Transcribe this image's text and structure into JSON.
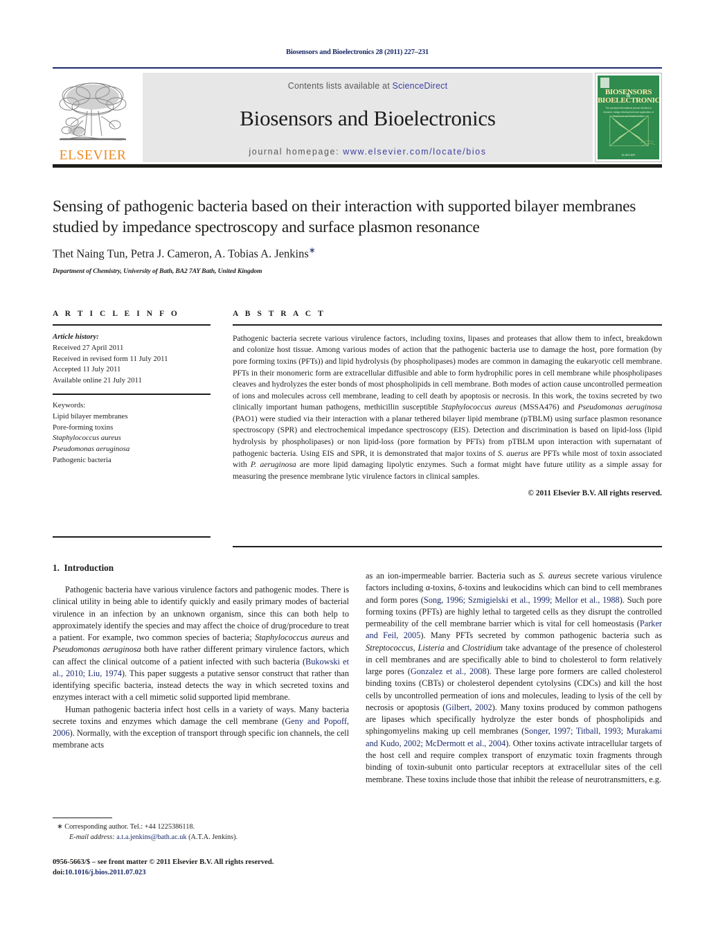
{
  "header": {
    "running_head": "Biosensors and Bioelectronics 28 (2011) 227–231",
    "contents_prefix": "Contents lists available at ",
    "contents_link": "ScienceDirect",
    "journal_title": "Biosensors and Bioelectronics",
    "homepage_prefix": "journal homepage: ",
    "homepage_url": "www.elsevier.com/locate/bios",
    "publisher_logo_text": "ELSEVIER",
    "cover": {
      "line1": "BIOSENSORS",
      "amp": "&",
      "line2": "BIOELECTRONICS",
      "subtitle": "The principal international journal devoted to research, design development and application of biosensors and bioelectronics",
      "footer": "ELSEVIER"
    },
    "colors": {
      "rule_navy": "#1b2a6b",
      "link_blue": "#3b3f9e",
      "elsevier_orange": "#ED8B22",
      "cover_green": "#2f8b4e",
      "box_grey": "#e7e7e7"
    }
  },
  "article": {
    "title": "Sensing of pathogenic bacteria based on their interaction with supported bilayer membranes studied by impedance spectroscopy and surface plasmon resonance",
    "authors": "Thet Naing Tun, Petra J. Cameron, A. Tobias A. Jenkins",
    "corresponding_marker": "∗",
    "affiliation": "Department of Chemistry, University of Bath, BA2 7AY Bath, United Kingdom"
  },
  "article_info": {
    "heading": "A R T I C L E   I N F O",
    "history_label": "Article history:",
    "history": [
      "Received 27 April 2011",
      "Received in revised form 11 July 2011",
      "Accepted 11 July 2011",
      "Available online 21 July 2011"
    ],
    "keywords_label": "Keywords:",
    "keywords": [
      "Lipid bilayer membranes",
      "Pore-forming toxins",
      "Staphylococcus aureus",
      "Pseudomonas aeruginosa",
      "Pathogenic bacteria"
    ],
    "keywords_italic": [
      false,
      false,
      true,
      true,
      false
    ]
  },
  "abstract": {
    "heading": "A B S T R A C T",
    "text": "Pathogenic bacteria secrete various virulence factors, including toxins, lipases and proteases that allow them to infect, breakdown and colonize host tissue. Among various modes of action that the pathogenic bacteria use to damage the host, pore formation (by pore forming toxins (PFTs)) and lipid hydrolysis (by phospholipases) modes are common in damaging the eukaryotic cell membrane. PFTs in their monomeric form are extracellular diffusible and able to form hydrophilic pores in cell membrane while phospholipases cleaves and hydrolyzes the ester bonds of most phospholipids in cell membrane. Both modes of action cause uncontrolled permeation of ions and molecules across cell membrane, leading to cell death by apoptosis or necrosis. In this work, the toxins secreted by two clinically important human pathogens, methicillin susceptible Staphylococcus aureus (MSSA476) and Pseudomonas aeruginosa (PAO1) were studied via their interaction with a planar tethered bilayer lipid membrane (pTBLM) using surface plasmon resonance spectroscopy (SPR) and electrochemical impedance spectroscopy (EIS). Detection and discrimination is based on lipid-loss (lipid hydrolysis by phospholipases) or non lipid-loss (pore formation by PFTs) from pTBLM upon interaction with supernatant of pathogenic bacteria. Using EIS and SPR, it is demonstrated that major toxins of S. auerus are PFTs while most of toxin associated with P. aeruginosa are more lipid damaging lipolytic enzymes. Such a format might have future utility as a simple assay for measuring the presence membrane lytic virulence factors in clinical samples.",
    "copyright": "© 2011 Elsevier B.V. All rights reserved."
  },
  "body": {
    "section_number": "1.",
    "section_title": "Introduction",
    "left_paragraphs": [
      "Pathogenic bacteria have various virulence factors and pathogenic modes. There is clinical utility in being able to identify quickly and easily primary modes of bacterial virulence in an infection by an unknown organism, since this can both help to approximately identify the species and may affect the choice of drug/procedure to treat a patient. For example, two common species of bacteria; Staphylococcus aureus and Pseudomonas aeruginosa both have rather different primary virulence factors, which can affect the clinical outcome of a patient infected with such bacteria (Bukowski et al., 2010; Liu, 1974). This paper suggests a putative sensor construct that rather than identifying specific bacteria, instead detects the way in which secreted toxins and enzymes interact with a cell mimetic solid supported lipid membrane.",
      "Human pathogenic bacteria infect host cells in a variety of ways. Many bacteria secrete toxins and enzymes which damage the cell membrane (Geny and Popoff, 2006). Normally, with the exception of transport through specific ion channels, the cell membrane acts"
    ],
    "right_paragraphs": [
      "as an ion-impermeable barrier. Bacteria such as S. aureus secrete various virulence factors including α-toxins, δ-toxins and leukocidins which can bind to cell membranes and form pores (Song, 1996; Szmigielski et al., 1999; Mellor et al., 1988). Such pore forming toxins (PFTs) are highly lethal to targeted cells as they disrupt the controlled permeability of the cell membrane barrier which is vital for cell homeostasis (Parker and Feil, 2005). Many PFTs secreted by common pathogenic bacteria such as Streptococcus, Listeria and Clostridium take advantage of the presence of cholesterol in cell membranes and are specifically able to bind to cholesterol to form relatively large pores (Gonzalez et al., 2008). These large pore formers are called cholesterol binding toxins (CBTs) or cholesterol dependent cytolysins (CDCs) and kill the host cells by uncontrolled permeation of ions and molecules, leading to lysis of the cell by necrosis or apoptosis (Gilbert, 2002). Many toxins produced by common pathogens are lipases which specifically hydrolyze the ester bonds of phospholipids and sphingomyelins making up cell membranes (Songer, 1997; Titball, 1993; Murakami and Kudo, 2002; McDermott et al., 2004). Other toxins activate intracellular targets of the host cell and require complex transport of enzymatic toxin fragments through binding of toxin-subunit onto particular receptors at extracellular sites of the cell membrane. These toxins include those that inhibit the release of neurotransmitters, e.g."
    ]
  },
  "footer": {
    "corresponding_marker": "∗",
    "corresponding_text": "Corresponding author. Tel.: +44 1225386118.",
    "email_label": "E-mail address:",
    "email": "a.t.a.jenkins@bath.ac.uk",
    "email_suffix": "(A.T.A. Jenkins).",
    "issn_line": "0956-5663/$ – see front matter © 2011 Elsevier B.V. All rights reserved.",
    "doi_prefix": "doi:",
    "doi": "10.1016/j.bios.2011.07.023"
  }
}
